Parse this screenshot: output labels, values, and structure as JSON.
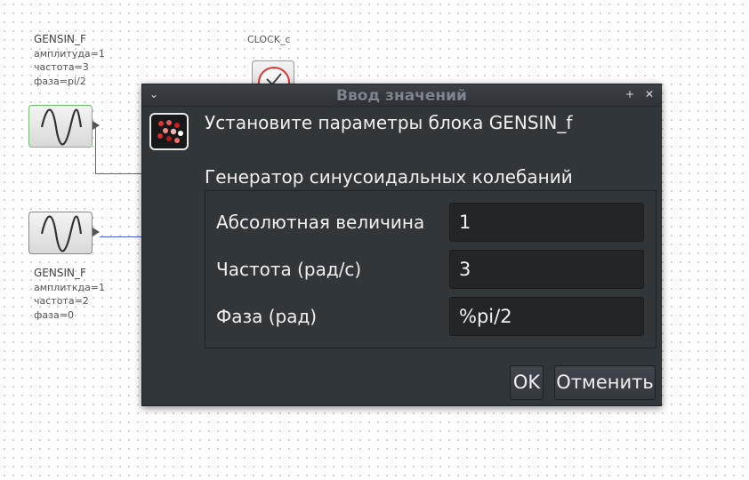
{
  "canvas": {
    "block_top": {
      "name": "GENSIN_F",
      "params": [
        "амплитуда=1",
        "частота=3",
        "фаза=pi/2"
      ]
    },
    "block_bottom": {
      "name": "GENSIN_F",
      "params": [
        "амплиткда=1",
        "частота=2",
        "фаза=0"
      ]
    },
    "clock": {
      "name": "CLOCK_c"
    },
    "link_color": "#4a5fd0"
  },
  "dialog": {
    "window_title": "Ввод значений",
    "heading": "Установите параметры блока GENSIN_f",
    "subheading": "Генератор синусоидальных колебаний",
    "fields": [
      {
        "label": "Абсолютная величина",
        "value": "1"
      },
      {
        "label": "Частота (рад/с)",
        "value": "3"
      },
      {
        "label": "Фаза (рад)",
        "value": "%pi/2"
      }
    ],
    "ok_label": "OK",
    "cancel_label": "Отменить",
    "icons": {
      "menu": "chevron-down-icon",
      "keep_above": "pin-icon",
      "close": "close-icon",
      "app": "scilab-app-icon"
    }
  }
}
